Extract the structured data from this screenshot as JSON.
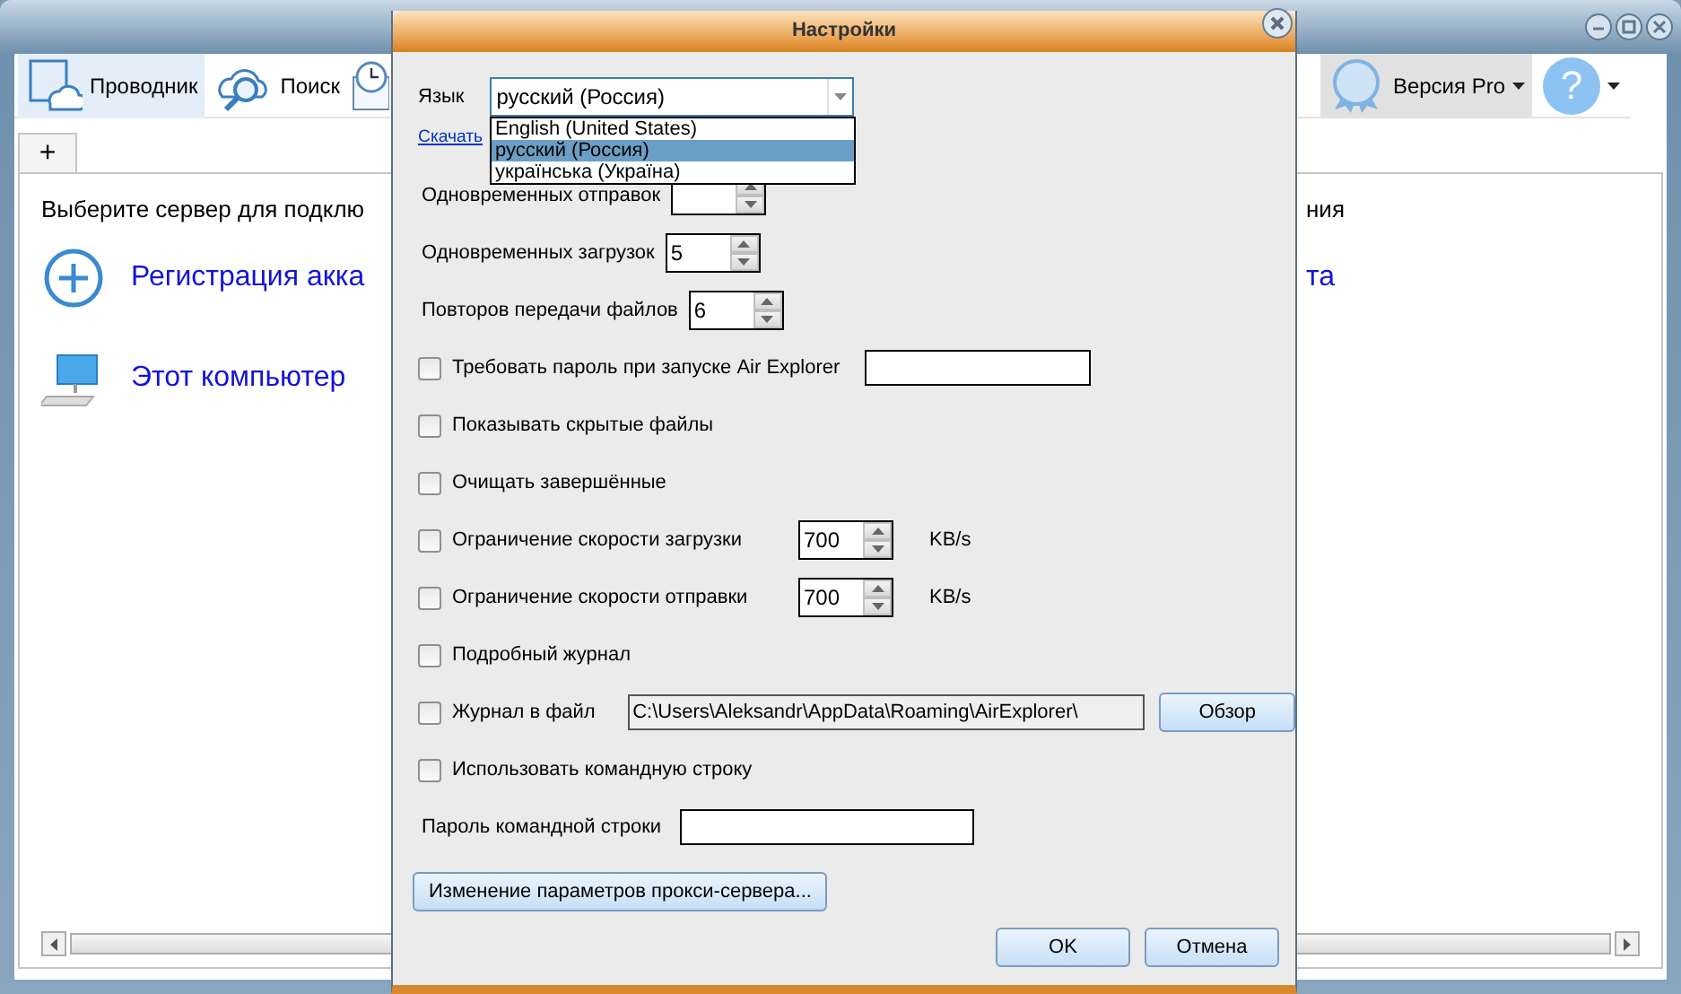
{
  "main_window": {
    "toolbar": [
      {
        "kind": "explorer",
        "label": "Проводник",
        "selected": true,
        "hovered": false,
        "dropdown": false
      },
      {
        "kind": "search",
        "label": "Поиск",
        "selected": false,
        "hovered": false,
        "dropdown": false
      },
      {
        "kind": "pro",
        "label": "Версия Pro",
        "selected": false,
        "hovered": true,
        "dropdown": true
      },
      {
        "kind": "help",
        "label": "?",
        "selected": false,
        "hovered": false,
        "dropdown": true
      }
    ],
    "tabs": [
      {
        "label": "+",
        "selected": true
      }
    ],
    "prompt": [
      "Выберите сервер для подклю",
      "ния"
    ],
    "servers": [
      {
        "kind": "add",
        "label": "Регистрация акка",
        "label_right": "та"
      },
      {
        "kind": "computer",
        "label": "Этот компьютер"
      }
    ]
  },
  "settings_dialog": {
    "title": "Настройки",
    "language": {
      "label": "Язык",
      "value": "русский (Россия)",
      "expanded": true,
      "options": [
        {
          "label": "English (United States)",
          "selected": false
        },
        {
          "label": "русский (Россия)",
          "selected": true
        },
        {
          "label": "українська (Україна)",
          "selected": false
        }
      ]
    },
    "download_link": "Скачать",
    "rows": [
      {
        "kind": "spin",
        "label": "Одновременных отправок"
      },
      {
        "kind": "spin",
        "label": "Одновременных загрузок",
        "value": "5"
      },
      {
        "kind": "spin",
        "label": "Повторов передачи файлов",
        "value": "6"
      },
      {
        "kind": "check_field",
        "label": "Требовать пароль при запуске Air Explorer",
        "checked": false
      },
      {
        "kind": "check",
        "label": "Показывать скрытые файлы",
        "checked": false
      },
      {
        "kind": "check",
        "label": "Очищать завершённые",
        "checked": false
      },
      {
        "kind": "check_spin",
        "label": "Ограничение скорости загрузки",
        "checked": false,
        "value": "700",
        "unit": "KB/s"
      },
      {
        "kind": "check_spin",
        "label": "Ограничение скорости отправки",
        "checked": false,
        "value": "700",
        "unit": "KB/s"
      },
      {
        "kind": "check",
        "label": "Подробный журнал",
        "checked": false
      },
      {
        "kind": "check_path",
        "label": "Журнал в файл",
        "checked": false,
        "value": "C:\\Users\\Aleksandr\\AppData\\Roaming\\AirExplorer\\",
        "button": "Обзор"
      },
      {
        "kind": "check",
        "label": "Использовать командную строку",
        "checked": false
      },
      {
        "kind": "field",
        "label": "Пароль командной строки"
      }
    ],
    "proxy_button": "Изменение параметров прокси-сервера...",
    "buttons": [
      "OK",
      "Отмена"
    ]
  }
}
